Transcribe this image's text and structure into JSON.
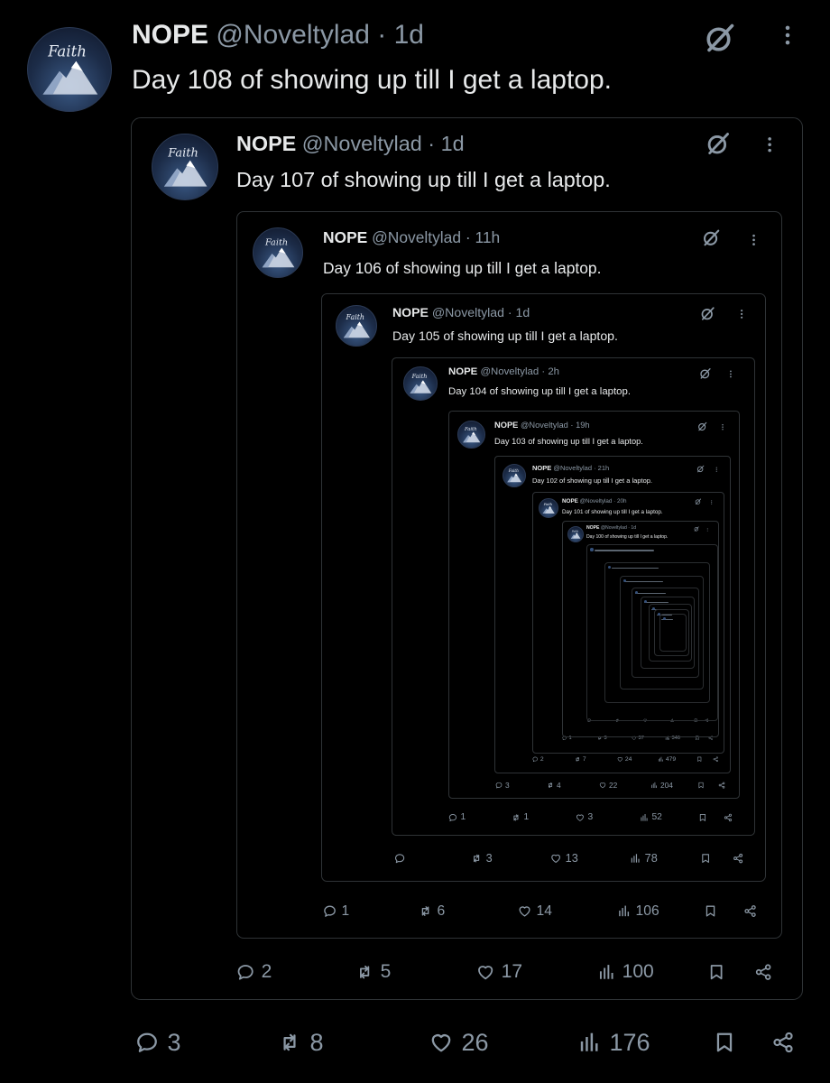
{
  "tweets": [
    {
      "name": "NOPE",
      "handle": "@Noveltylad",
      "time": "1d",
      "text": "Day 108 of showing up till I get a laptop.",
      "replies": "3",
      "reposts": "8",
      "likes": "26",
      "views": "176"
    },
    {
      "name": "NOPE",
      "handle": "@Noveltylad",
      "time": "1d",
      "text": "Day 107 of showing up till I get a laptop.",
      "replies": "2",
      "reposts": "5",
      "likes": "17",
      "views": "100"
    },
    {
      "name": "NOPE",
      "handle": "@Noveltylad",
      "time": "11h",
      "text": "Day 106 of showing up till I get a laptop.",
      "replies": "1",
      "reposts": "6",
      "likes": "14",
      "views": "106"
    },
    {
      "name": "NOPE",
      "handle": "@Noveltylad",
      "time": "1d",
      "text": "Day 105 of showing up till I get a laptop.",
      "replies": "",
      "reposts": "3",
      "likes": "13",
      "views": "78"
    },
    {
      "name": "NOPE",
      "handle": "@Noveltylad",
      "time": "2h",
      "text": "Day 104 of showing up till I get a laptop.",
      "replies": "1",
      "reposts": "1",
      "likes": "3",
      "views": "52"
    },
    {
      "name": "NOPE",
      "handle": "@Noveltylad",
      "time": "19h",
      "text": "Day 103 of showing up till I get a laptop.",
      "replies": "3",
      "reposts": "4",
      "likes": "22",
      "views": "204"
    },
    {
      "name": "NOPE",
      "handle": "@Noveltylad",
      "time": "21h",
      "text": "Day 102 of showing up till I get a laptop.",
      "replies": "2",
      "reposts": "7",
      "likes": "24",
      "views": "479"
    },
    {
      "name": "NOPE",
      "handle": "@Noveltylad",
      "time": "20h",
      "text": "Day 101 of showing up till I get a laptop.",
      "replies": "1",
      "reposts": "3",
      "likes": "37",
      "views": "346"
    },
    {
      "name": "NOPE",
      "handle": "@Noveltylad",
      "time": "1d",
      "text": "Day 100 of showing up till I get a laptop.",
      "replies": "",
      "reposts": "",
      "likes": "",
      "views": ""
    }
  ],
  "icons": {
    "avatar": "avatar-logo",
    "grok": "grok-icon",
    "more": "more-icon",
    "reply": "reply-icon",
    "repost": "repost-icon",
    "like": "like-icon",
    "views": "views-icon",
    "bookmark": "bookmark-icon",
    "share": "share-icon"
  },
  "colors": {
    "background": "#000000",
    "text": "#e7e9ea",
    "secondary": "#8b98a5",
    "border": "#2f3336"
  }
}
